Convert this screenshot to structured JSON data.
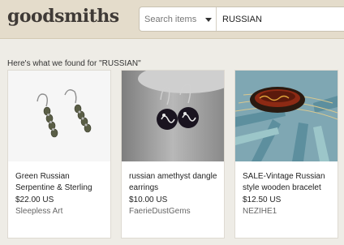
{
  "header": {
    "logo": "goodsmiths",
    "search": {
      "scope_placeholder": "Search items",
      "query": "RUSSIAN"
    }
  },
  "results": {
    "heading": "Here's what we found for \"RUSSIAN\"",
    "items": [
      {
        "title": "Green Russian Serpentine & Sterling",
        "price": "$22.00 US",
        "shop": "Sleepless Art"
      },
      {
        "title": "russian amethyst dangle earrings",
        "price": "$10.00 US",
        "shop": "FaerieDustGems"
      },
      {
        "title": "SALE-Vintage Russian style wooden bracelet",
        "price": "$12.50 US",
        "shop": "NEZIHE1"
      }
    ]
  }
}
